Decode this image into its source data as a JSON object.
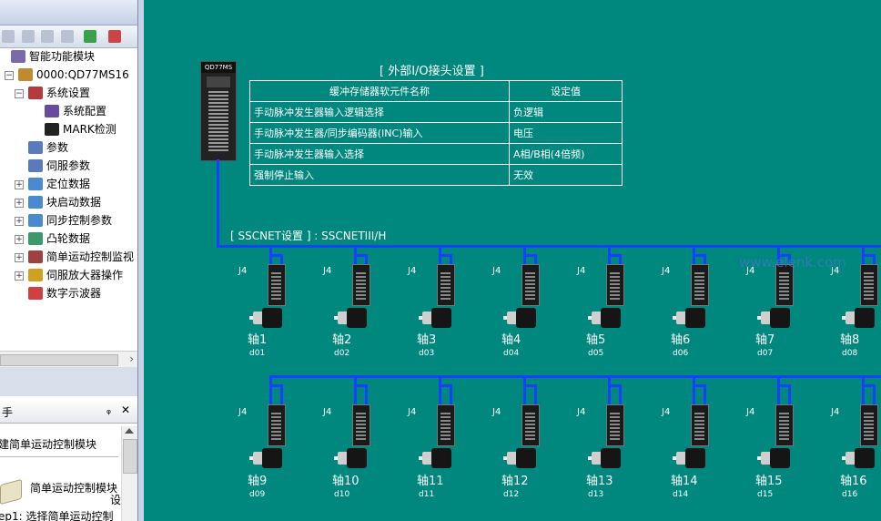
{
  "sidebar": {
    "tree": [
      {
        "label": "智能功能模块",
        "level": 0,
        "icon": "module-folder-icon"
      },
      {
        "label": "0000:QD77MS16",
        "level": 1,
        "icon": "plc-module-icon"
      },
      {
        "label": "系统设置",
        "level": 2,
        "icon": "system-settings-icon"
      },
      {
        "label": "系统配置",
        "level": 3,
        "icon": "system-config-icon"
      },
      {
        "label": "MARK检测",
        "level": 3,
        "icon": "mark-detect-icon"
      },
      {
        "label": "参数",
        "level": 2,
        "icon": "parameter-icon"
      },
      {
        "label": "伺服参数",
        "level": 2,
        "icon": "servo-parameter-icon"
      },
      {
        "label": "定位数据",
        "level": 2,
        "icon": "positioning-data-icon"
      },
      {
        "label": "块启动数据",
        "level": 2,
        "icon": "block-start-icon"
      },
      {
        "label": "同步控制参数",
        "level": 2,
        "icon": "sync-control-icon"
      },
      {
        "label": "凸轮数据",
        "level": 2,
        "icon": "cam-data-icon"
      },
      {
        "label": "简单运动控制监视",
        "level": 2,
        "icon": "monitor-icon"
      },
      {
        "label": "伺服放大器操作",
        "level": 2,
        "icon": "servo-amp-op-icon"
      },
      {
        "label": "数字示波器",
        "level": 2,
        "icon": "oscilloscope-icon"
      }
    ],
    "scroll_arrow": "›",
    "panel": {
      "title": "手",
      "pin": "ᵩ",
      "close": "✕",
      "heading": "建简单运动控制模块",
      "item_title": "简单运动控制模块",
      "item_suffix": "设",
      "step": "ep1: 选择简单运动控制"
    }
  },
  "main": {
    "controller_label": "QD77MS",
    "io_title": "[ 外部I/O接头设置 ]",
    "io_table": {
      "headers": [
        "缓冲存储器软元件名称",
        "设定值"
      ],
      "rows": [
        [
          "手动脉冲发生器输入逻辑选择",
          "负逻辑"
        ],
        [
          "手动脉冲发生器/同步编码器(INC)输入",
          "电压"
        ],
        [
          "手动脉冲发生器输入选择",
          "A相/B相(4倍频)"
        ],
        [
          "强制停止输入",
          "无效"
        ]
      ]
    },
    "sscnet_title": "[ SSCNET设置 ] : SSCNETIII/H",
    "connector_label": "J4",
    "axes": [
      {
        "name": "轴1",
        "id": "d01"
      },
      {
        "name": "轴2",
        "id": "d02"
      },
      {
        "name": "轴3",
        "id": "d03"
      },
      {
        "name": "轴4",
        "id": "d04"
      },
      {
        "name": "轴5",
        "id": "d05"
      },
      {
        "name": "轴6",
        "id": "d06"
      },
      {
        "name": "轴7",
        "id": "d07"
      },
      {
        "name": "轴8",
        "id": "d08"
      },
      {
        "name": "轴9",
        "id": "d09"
      },
      {
        "name": "轴10",
        "id": "d10"
      },
      {
        "name": "轴11",
        "id": "d11"
      },
      {
        "name": "轴12",
        "id": "d12"
      },
      {
        "name": "轴13",
        "id": "d13"
      },
      {
        "name": "轴14",
        "id": "d14"
      },
      {
        "name": "轴15",
        "id": "d15"
      },
      {
        "name": "轴16",
        "id": "d16"
      }
    ],
    "watermark": "www.elenk.com"
  },
  "colors": {
    "canvas": "#00877e",
    "wire": "#1740ff",
    "text": "#ffffff"
  }
}
